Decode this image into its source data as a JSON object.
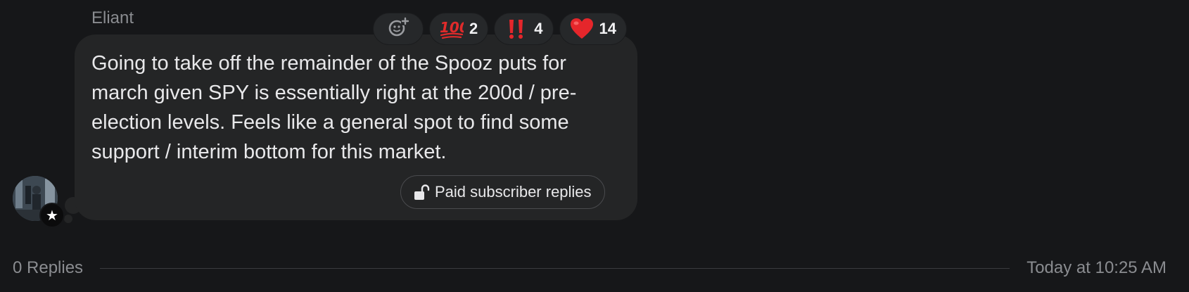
{
  "message": {
    "author": "Eliant",
    "text": "Going to take off the remainder of the Spooz puts for march given SPY is essentially right at the 200d / pre-election levels. Feels like a general spot to find some support / interim bottom for this market.",
    "paid_replies_label": "Paid subscriber replies"
  },
  "reactions": [
    {
      "icon": "add-reaction-icon",
      "count": ""
    },
    {
      "icon": "hundred-points-icon",
      "count": "2"
    },
    {
      "icon": "double-exclamation-icon",
      "count": "4"
    },
    {
      "icon": "red-heart-icon",
      "count": "14"
    }
  ],
  "footer": {
    "replies": "0 Replies",
    "timestamp": "Today at 10:25 AM"
  },
  "colors": {
    "background": "#161719",
    "bubble": "#242526",
    "muted_text": "#8a8c90",
    "heart": "#e5262b",
    "exclamation": "#e5262b"
  }
}
